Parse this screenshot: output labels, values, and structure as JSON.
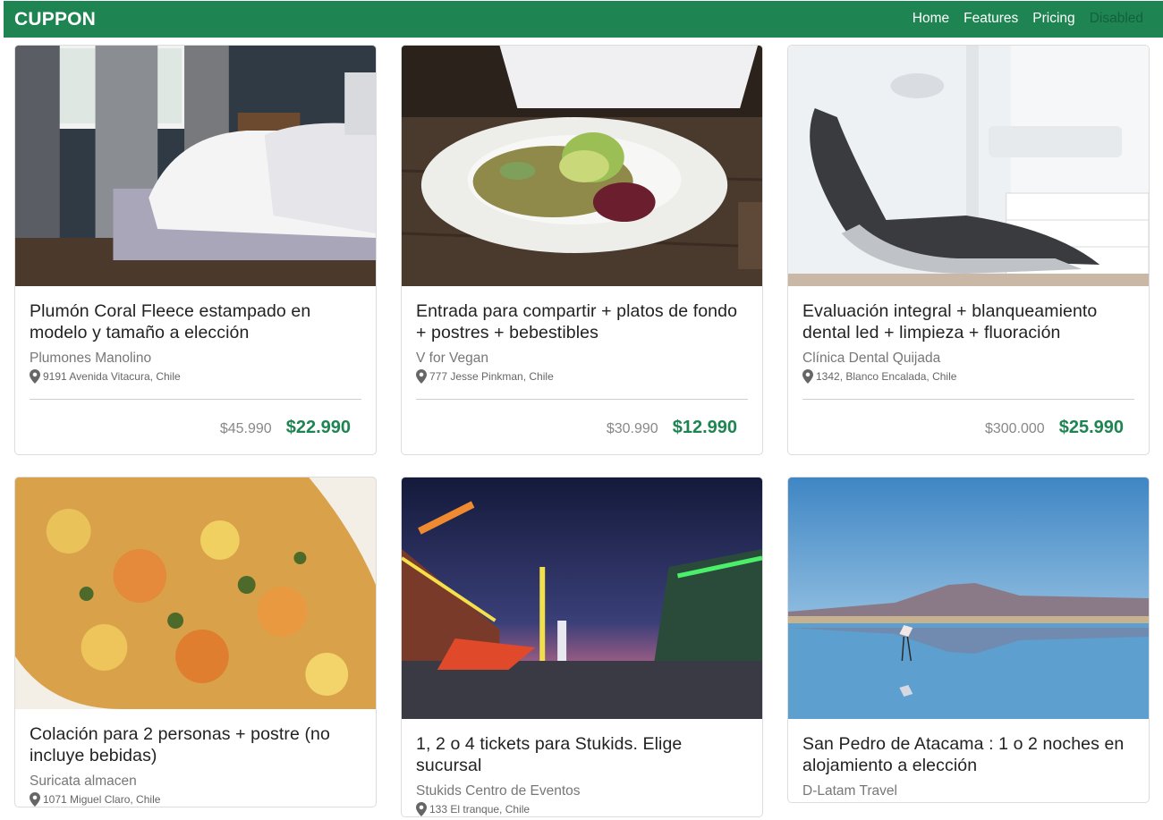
{
  "navbar": {
    "brand": "CUPPON",
    "links": [
      {
        "label": "Home"
      },
      {
        "label": "Features"
      },
      {
        "label": "Pricing"
      },
      {
        "label": "Disabled"
      }
    ]
  },
  "colors": {
    "brand_green": "#1e8452",
    "text_dark": "#222222",
    "text_muted": "#777777",
    "nav_disabled": "rgba(0,0,0,0.28)"
  },
  "deals": [
    {
      "image": "bedroom-bed-photo",
      "title": "Plumón Coral Fleece estampado en modelo y tamaño a elección",
      "merchant": "Plumones Manolino",
      "address": "9191 Avenida Vitacura, Chile",
      "old_price": "$45.990",
      "new_price": "$22.990"
    },
    {
      "image": "vegan-salad-plate-photo",
      "title": "Entrada para compartir + platos de fondo + postres + bebestibles",
      "merchant": "V for Vegan",
      "address": "777 Jesse Pinkman, Chile",
      "old_price": "$30.990",
      "new_price": "$12.990"
    },
    {
      "image": "dental-chair-photo",
      "title": "Evaluación integral + blanqueamiento dental led + limpieza + fluoración",
      "merchant": "Clínica Dental Quijada",
      "address": "1342, Blanco Encalada, Chile",
      "old_price": "$300.000",
      "new_price": "$25.990"
    },
    {
      "image": "rice-dish-closeup-photo",
      "title": "Colación para 2 personas + postre (no incluye bebidas)",
      "merchant": "Suricata almacen",
      "address": "1071 Miguel Claro, Chile"
    },
    {
      "image": "night-fair-photo",
      "title": "1, 2 o 4 tickets para Stukids. Elige sucursal",
      "merchant": "Stukids Centro de Eventos",
      "address": "133 El tranque, Chile"
    },
    {
      "image": "atacama-flamingo-lake-photo",
      "title": "San Pedro de Atacama : 1 o 2 noches en alojamiento a elección",
      "merchant": "D-Latam Travel"
    }
  ]
}
